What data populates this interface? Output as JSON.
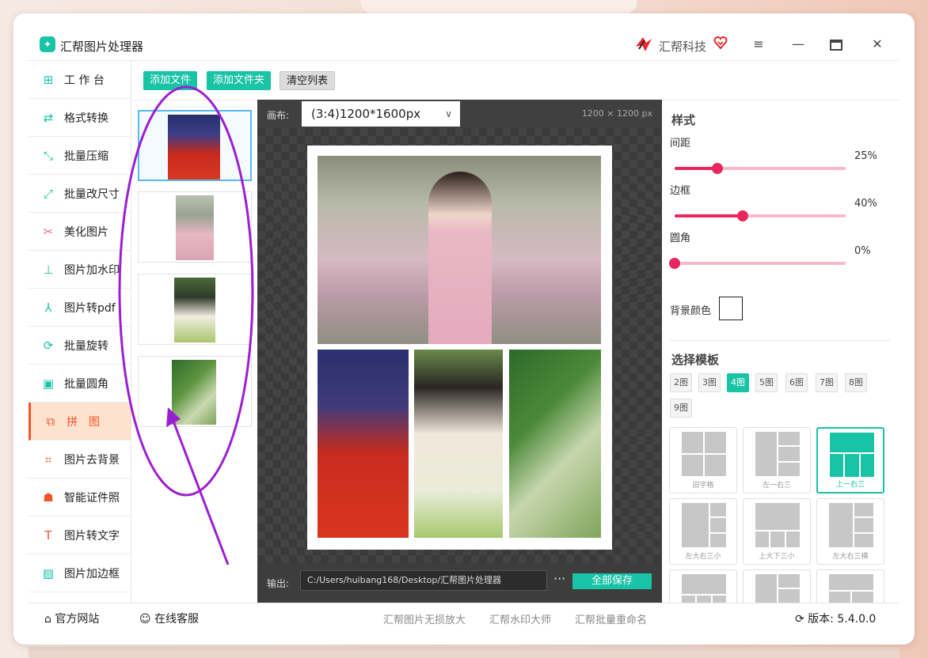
{
  "app": {
    "title": "汇帮图片处理器",
    "brand": "汇帮科技"
  },
  "window_controls": {
    "menu": "≡",
    "minimize": "—",
    "maximize": "□",
    "close": "✕"
  },
  "sidebar": {
    "items": [
      {
        "label": "工 作 台",
        "icon": "grid-icon"
      },
      {
        "label": "格式转换",
        "icon": "convert-icon"
      },
      {
        "label": "批量压缩",
        "icon": "compress-icon"
      },
      {
        "label": "批量改尺寸",
        "icon": "resize-icon"
      },
      {
        "label": "美化图片",
        "icon": "beautify-icon"
      },
      {
        "label": "图片加水印",
        "icon": "watermark-icon"
      },
      {
        "label": "图片转pdf",
        "icon": "pdf-icon"
      },
      {
        "label": "批量旋转",
        "icon": "rotate-icon"
      },
      {
        "label": "批量圆角",
        "icon": "rounded-corner-icon"
      },
      {
        "label": "拼　图",
        "icon": "collage-icon",
        "active": true
      },
      {
        "label": "图片去背景",
        "icon": "crop-icon"
      },
      {
        "label": "智能证件照",
        "icon": "id-photo-icon"
      },
      {
        "label": "图片转文字",
        "icon": "text-icon"
      },
      {
        "label": "图片加边框",
        "icon": "frame-icon"
      }
    ]
  },
  "toolbar": {
    "add_file": "添加文件",
    "add_folder": "添加文件夹",
    "clear_list": "清空列表"
  },
  "preview": {
    "canvas_label": "画布:",
    "canvas_value": "(3:4)1200*1600px",
    "canvas_size": "1200 × 1200 px",
    "output_label": "输出:",
    "output_path": "C:/Users/huibang168/Desktop/汇帮图片处理器",
    "more": "···",
    "save_all": "全部保存"
  },
  "style_panel": {
    "title": "样式",
    "spacing": {
      "label": "间距",
      "value": 25,
      "display": "25%"
    },
    "border": {
      "label": "边框",
      "value": 40,
      "display": "40%"
    },
    "radius": {
      "label": "圆角",
      "value": 0,
      "display": "0%"
    },
    "bg_color_label": "背景颜色",
    "bg_color": "#ffffff"
  },
  "template_panel": {
    "title": "选择模板",
    "counts": [
      "2图",
      "3图",
      "4图",
      "5图",
      "6图",
      "7图",
      "8图",
      "9图"
    ],
    "active_count": "4图",
    "templates": [
      "田字格",
      "左一右三",
      "上一右三",
      "左大右三小",
      "上大下三小",
      "左大右三横",
      "",
      "",
      ""
    ],
    "active_template": "上一右三"
  },
  "footer": {
    "website": "官方网站",
    "support": "在线客服",
    "links": [
      "汇帮图片无损放大",
      "汇帮水印大师",
      "汇帮批量重命名"
    ],
    "version_label": "版本:",
    "version": "5.4.0.0"
  },
  "colors": {
    "accent": "#19c3a6",
    "active": "#f0552a",
    "slider": "#e8275f",
    "annotation": "#9b1fd1"
  }
}
